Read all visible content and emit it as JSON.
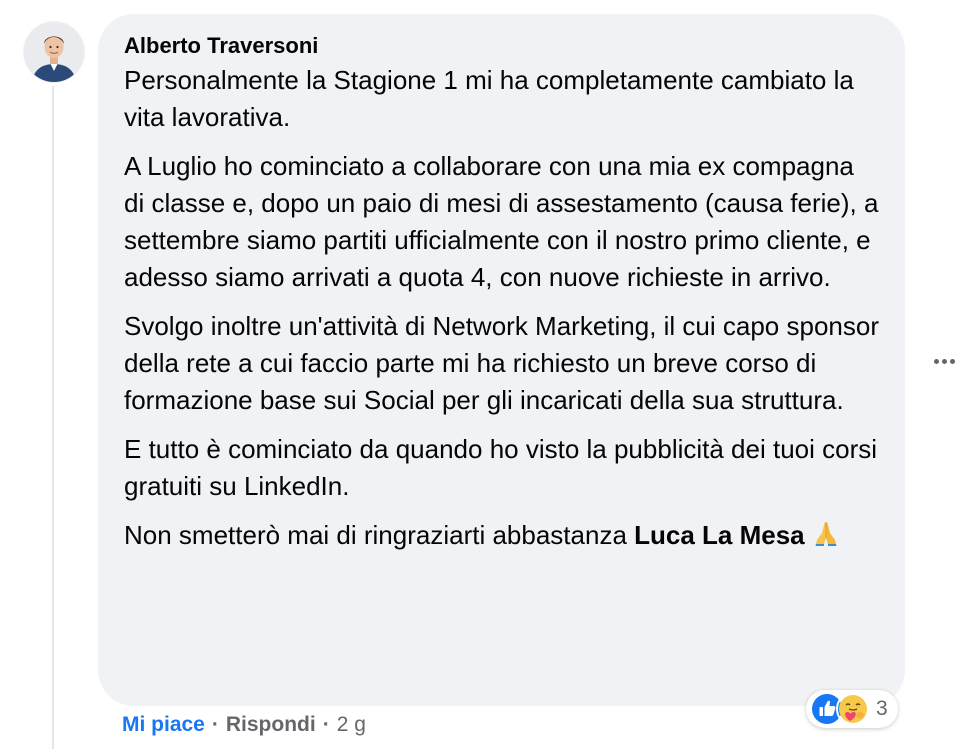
{
  "comment": {
    "author": "Alberto Traversoni",
    "paragraphs": [
      "Personalmente la Stagione 1 mi ha completamente cambiato la vita lavorativa.",
      "A Luglio ho cominciato a collaborare con una mia ex compagna di classe e, dopo un paio di mesi di assestamento (causa ferie), a settembre siamo partiti ufficialmente con il nostro primo cliente, e adesso siamo arrivati a quota 4, con nuove richieste in arrivo.",
      "Svolgo inoltre un'attività di Network Marketing, il cui capo sponsor della rete a cui faccio parte mi ha richiesto un breve corso di formazione base sui Social per gli incaricati della sua struttura.",
      "E tutto è cominciato da quando ho visto la pubblicità dei tuoi corsi gratuiti su LinkedIn."
    ],
    "last_paragraph_text": "Non smetterò mai di ringraziarti abbastanza ",
    "mention": "Luca La Mesa",
    "emoji_icon": "folded-hands-icon"
  },
  "actions": {
    "like_label": "Mi piace",
    "separator": "·",
    "reply_label": "Rispondi",
    "time": "2 g"
  },
  "reactions": {
    "icons": [
      "like-reaction-icon",
      "care-reaction-icon"
    ],
    "count": "3"
  },
  "colors": {
    "bubble": "#f0f2f5",
    "text": "#050505",
    "secondary": "#65676b",
    "accent": "#1877f2"
  }
}
